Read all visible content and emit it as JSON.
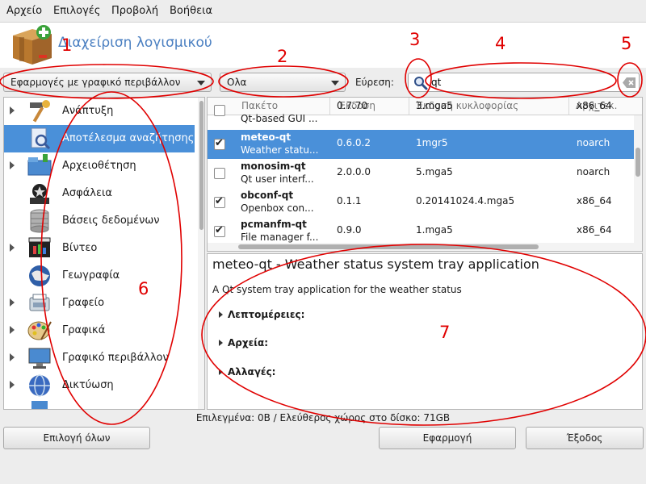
{
  "menubar": {
    "items": [
      {
        "label": "Αρχείο"
      },
      {
        "label": "Επιλογές"
      },
      {
        "label": "Προβολή"
      },
      {
        "label": "Βοήθεια"
      }
    ]
  },
  "header": {
    "title": "Διαχείριση λογισμικού",
    "icon": "package-box-icon"
  },
  "filters": {
    "type_selected": "Εφαρμογές με γραφικό περιβάλλον",
    "status_selected": "Ολα"
  },
  "search": {
    "label": "Εύρεση:",
    "value": "qt",
    "icon": "magnifier-icon",
    "clear_icon": "clear-icon"
  },
  "categories": [
    {
      "label": "Ανάπτυξη",
      "icon": "hammer-icon",
      "expandable": true,
      "selected": false
    },
    {
      "label": "Αποτέλεσμα αναζήτησης",
      "icon": "search-results-icon",
      "expandable": false,
      "selected": true
    },
    {
      "label": "Αρχειοθέτηση",
      "icon": "archive-icon",
      "expandable": true,
      "selected": false
    },
    {
      "label": "Ασφάλεια",
      "icon": "security-icon",
      "expandable": false,
      "selected": false
    },
    {
      "label": "Βάσεις δεδομένων",
      "icon": "database-icon",
      "expandable": false,
      "selected": false
    },
    {
      "label": "Βίντεο",
      "icon": "video-icon",
      "expandable": true,
      "selected": false
    },
    {
      "label": "Γεωγραφία",
      "icon": "geography-icon",
      "expandable": false,
      "selected": false
    },
    {
      "label": "Γραφείο",
      "icon": "office-icon",
      "expandable": true,
      "selected": false
    },
    {
      "label": "Γραφικά",
      "icon": "graphics-icon",
      "expandable": true,
      "selected": false
    },
    {
      "label": "Γραφικό περιβάλλον",
      "icon": "desktop-icon",
      "expandable": true,
      "selected": false
    },
    {
      "label": "Δικτύωση",
      "icon": "network-icon",
      "expandable": true,
      "selected": false
    }
  ],
  "table": {
    "headers": [
      "Πακέτο",
      "Έκδοση",
      "Έκδοση κυκλοφορίας",
      "Αρχιτεκ."
    ],
    "rows": [
      {
        "name": "",
        "summary": "Qt-based GUI ...",
        "version": "0.7.70",
        "release": "3.mga5",
        "arch": "x86_64",
        "checked": false,
        "selected": false
      },
      {
        "name": "meteo-qt",
        "summary": "Weather statu...",
        "version": "0.6.0.2",
        "release": "1mgr5",
        "arch": "noarch",
        "checked": true,
        "selected": true
      },
      {
        "name": "monosim-qt",
        "summary": "Qt user interf...",
        "version": "2.0.0.0",
        "release": "5.mga5",
        "arch": "noarch",
        "checked": false,
        "selected": false
      },
      {
        "name": "obconf-qt",
        "summary": "Openbox con...",
        "version": "0.1.1",
        "release": "0.20141024.4.mga5",
        "arch": "x86_64",
        "checked": true,
        "selected": false
      },
      {
        "name": "pcmanfm-qt",
        "summary": "File manager f...",
        "version": "0.9.0",
        "release": "1.mga5",
        "arch": "x86_64",
        "checked": true,
        "selected": false
      }
    ]
  },
  "description": {
    "title": "meteo-qt - Weather status system tray application",
    "text": "A Qt system tray application for the weather status",
    "sections": [
      "Λεπτομέρειες:",
      "Αρχεία:",
      "Αλλαγές:"
    ]
  },
  "status": "Επιλεγμένα: 0B / Ελεύθερος χώρος στο δίσκο: 71GB",
  "buttons": {
    "select_all": "Επιλογή όλων",
    "apply": "Εφαρμογή",
    "exit": "Έξοδος"
  },
  "annotations": [
    "1",
    "2",
    "3",
    "4",
    "5",
    "6",
    "7"
  ],
  "colors": {
    "accent": "#4a90d9",
    "title": "#4a7fc1",
    "annotation": "#e00000"
  }
}
